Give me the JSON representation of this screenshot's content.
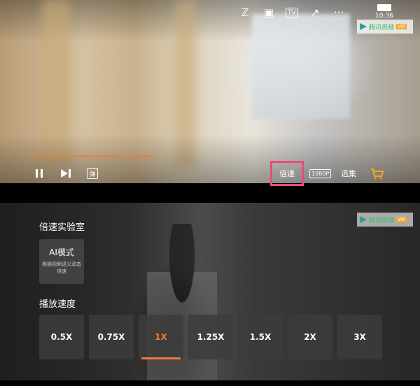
{
  "status_bar": {
    "time": "10:36"
  },
  "top_icons": [
    {
      "name": "zoom-icon",
      "glyph": "ℤ"
    },
    {
      "name": "screenshot-icon",
      "glyph": "▣"
    },
    {
      "name": "tv-icon",
      "glyph": "TV"
    },
    {
      "name": "share-icon",
      "glyph": "↗"
    },
    {
      "name": "more-icon",
      "glyph": "···"
    }
  ],
  "logo": {
    "text": "腾讯视频",
    "tag": "VIP"
  },
  "controls": {
    "speed_label": "倍速",
    "quality_label": "1080P",
    "episodes_label": "选集",
    "danmu_label": "弹"
  },
  "panel": {
    "lab_title": "倍速实验室",
    "ai_mode_title": "AI模式",
    "ai_mode_desc": "根据视频语义动态倍速",
    "playback_title": "播放速度",
    "speeds": [
      "0.5X",
      "0.75X",
      "1X",
      "1.25X",
      "1.5X",
      "2X",
      "3X"
    ],
    "selected_speed": "1X"
  },
  "colors": {
    "accent": "#f07c32",
    "highlight_border": "#e74c7c"
  }
}
